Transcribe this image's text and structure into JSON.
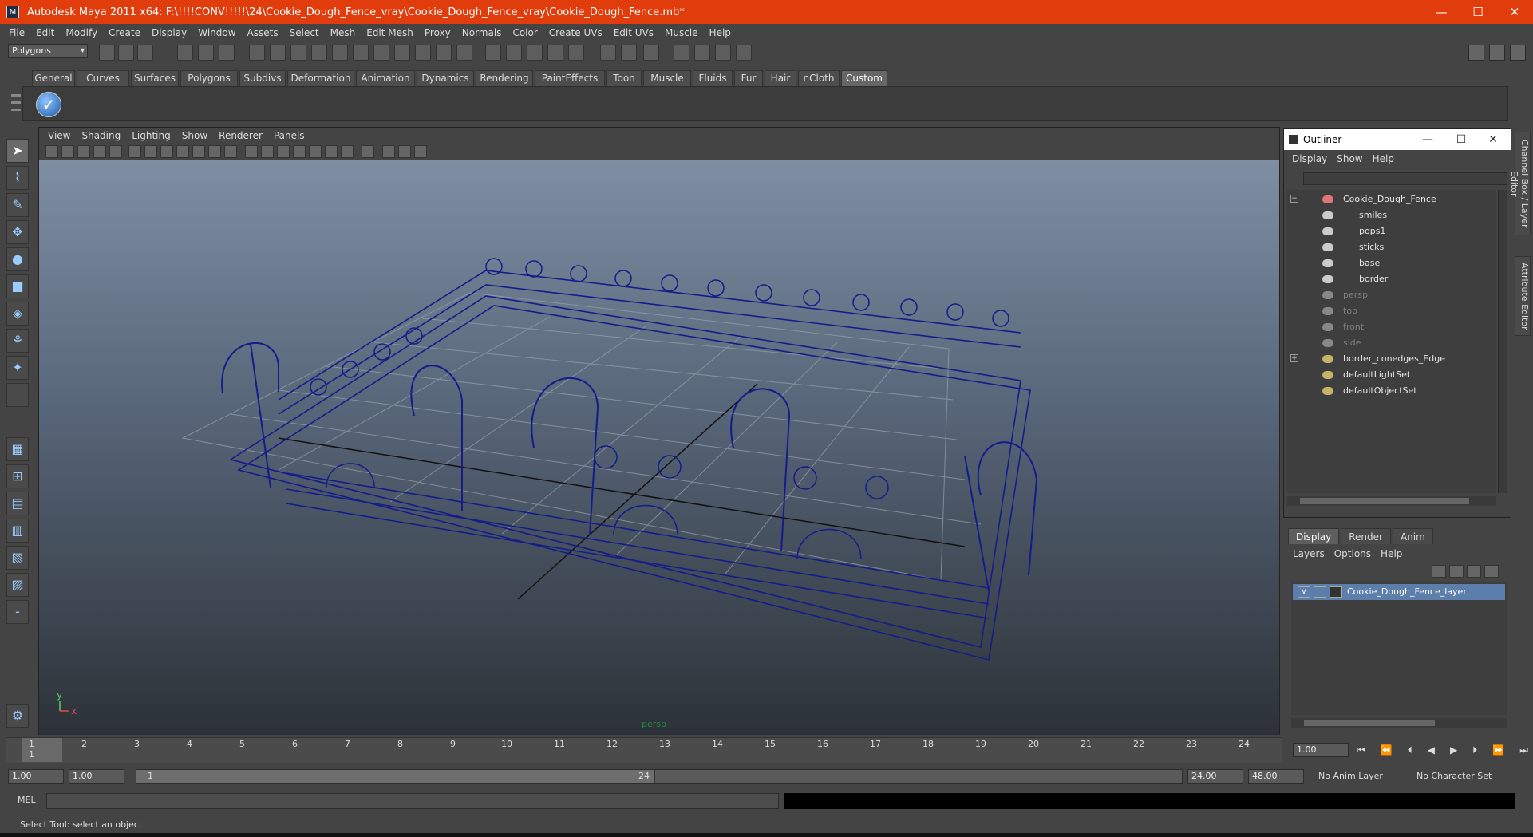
{
  "window": {
    "title": "Autodesk Maya 2011 x64: F:\\!!!!CONV!!!!!\\24\\Cookie_Dough_Fence_vray\\Cookie_Dough_Fence_vray\\Cookie_Dough_Fence.mb*",
    "minimize": "—",
    "maximize": "☐",
    "close": "✕"
  },
  "menubar": [
    "File",
    "Edit",
    "Modify",
    "Create",
    "Display",
    "Window",
    "Assets",
    "Select",
    "Mesh",
    "Edit Mesh",
    "Proxy",
    "Normals",
    "Color",
    "Create UVs",
    "Edit UVs",
    "Muscle",
    "Help"
  ],
  "statusline": {
    "mode": "Polygons"
  },
  "shelf": {
    "tabs": [
      "General",
      "Curves",
      "Surfaces",
      "Polygons",
      "Subdivs",
      "Deformation",
      "Animation",
      "Dynamics",
      "Rendering",
      "PaintEffects",
      "Toon",
      "Muscle",
      "Fluids",
      "Fur",
      "Hair",
      "nCloth",
      "Custom"
    ],
    "active_tab": "Custom",
    "check_icon": "✓"
  },
  "viewport": {
    "menu": [
      "View",
      "Shading",
      "Lighting",
      "Show",
      "Renderer",
      "Panels"
    ],
    "camera_label": "persp",
    "axis_x": "x",
    "axis_y": "y"
  },
  "outliner": {
    "title": "Outliner",
    "min": "—",
    "max": "☐",
    "close": "✕",
    "menu": [
      "Display",
      "Show",
      "Help"
    ],
    "items": [
      {
        "label": "Cookie_Dough_Fence",
        "expander": "−",
        "dim": false
      },
      {
        "label": "smiles",
        "dim": false
      },
      {
        "label": "pops1",
        "dim": false
      },
      {
        "label": "sticks",
        "dim": false
      },
      {
        "label": "base",
        "dim": false
      },
      {
        "label": "border",
        "dim": false
      },
      {
        "label": "persp",
        "dim": true
      },
      {
        "label": "top",
        "dim": true
      },
      {
        "label": "front",
        "dim": true
      },
      {
        "label": "side",
        "dim": true
      },
      {
        "label": "border_conedges_Edge",
        "expander": "+",
        "dim": false
      },
      {
        "label": "defaultLightSet",
        "dim": false
      },
      {
        "label": "defaultObjectSet",
        "dim": false
      }
    ]
  },
  "layer_editor": {
    "tabs": [
      "Display",
      "Render",
      "Anim"
    ],
    "active_tab": "Display",
    "menu": [
      "Layers",
      "Options",
      "Help"
    ],
    "layer_visible": "V",
    "layer_name": "Cookie_Dough_Fence_layer"
  },
  "sidebar_tabs": [
    "Channel Box / Layer Editor",
    "Attribute Editor"
  ],
  "timeslider": {
    "ticks": [
      "1",
      "2",
      "3",
      "4",
      "5",
      "6",
      "7",
      "8",
      "9",
      "10",
      "11",
      "12",
      "13",
      "14",
      "15",
      "16",
      "17",
      "18",
      "19",
      "20",
      "21",
      "22",
      "23",
      "24"
    ],
    "current_frame": "1",
    "current_time": "1.00",
    "playback_icons": [
      "⏮",
      "⏪",
      "⏴",
      "◀",
      "▶",
      "⏵",
      "⏩",
      "⏭"
    ]
  },
  "range": {
    "start": "1.00",
    "anim_start": "1.00",
    "slider_start": "1",
    "slider_end": "24",
    "end": "24.00",
    "anim_end": "48.00",
    "anim_layer": "No Anim Layer",
    "character_set": "No Character Set"
  },
  "cmdline": {
    "label": "MEL"
  },
  "helpline": {
    "text": "Select Tool: select an object"
  }
}
